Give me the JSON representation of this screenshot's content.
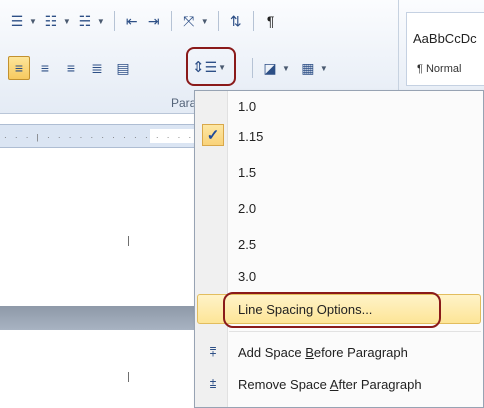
{
  "ribbon": {
    "group_label": "Paragraph",
    "styles": {
      "sample": "AaBbCcDc",
      "name": "¶ Normal"
    }
  },
  "line_spacing_menu": {
    "items": [
      {
        "label": "1.0",
        "checked": false
      },
      {
        "label": "1.15",
        "checked": true
      },
      {
        "label": "1.5",
        "checked": false
      },
      {
        "label": "2.0",
        "checked": false
      },
      {
        "label": "2.5",
        "checked": false
      },
      {
        "label": "3.0",
        "checked": false
      }
    ],
    "options_label": "Line Spacing Options...",
    "add_space_before": {
      "pre": "Add Space ",
      "key": "B",
      "post": "efore Paragraph"
    },
    "remove_space_after": {
      "pre": "Remove Space ",
      "key": "A",
      "post": "fter Paragraph"
    },
    "check_mark": "✓"
  },
  "colors": {
    "highlight": "#fde597",
    "annotation_ring": "#8a1a1a",
    "ribbon_icon": "#2d4f86"
  }
}
